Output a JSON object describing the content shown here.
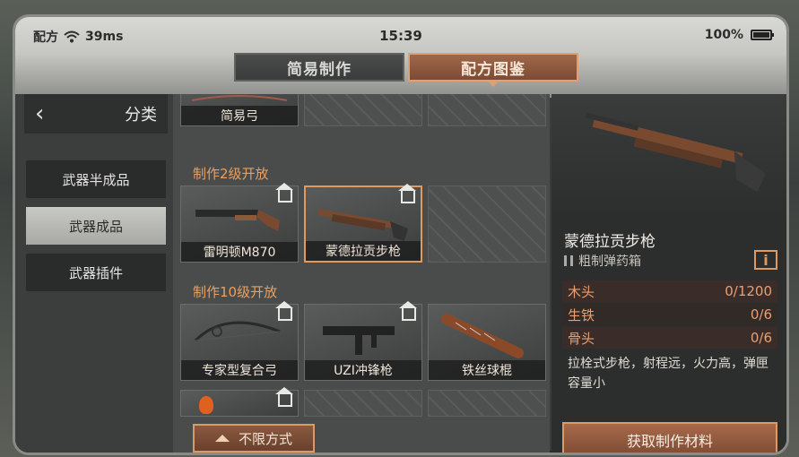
{
  "status": {
    "carrier": "配方",
    "ping": "39ms",
    "time": "15:39",
    "battery": "100%"
  },
  "tabs": [
    {
      "label": "简易制作",
      "active": false
    },
    {
      "label": "配方图鉴",
      "active": true
    }
  ],
  "sidebar": {
    "title": "分类",
    "items": [
      {
        "label": "武器半成品",
        "active": false
      },
      {
        "label": "武器成品",
        "active": true
      },
      {
        "label": "武器插件",
        "active": false
      }
    ]
  },
  "grid": {
    "top_item": "简易弓",
    "section2": "制作2级开放",
    "row2": [
      "雷明顿M870",
      "蒙德拉贡步枪"
    ],
    "section3": "制作10级开放",
    "row3": [
      "专家型复合弓",
      "UZI冲锋枪",
      "铁丝球棍"
    ],
    "filter_label": "不限方式"
  },
  "detail": {
    "name": "蒙德拉贡步枪",
    "ammo": "粗制弹药箱",
    "info": "i",
    "materials": [
      {
        "name": "木头",
        "count": "0/1200"
      },
      {
        "name": "生铁",
        "count": "0/6"
      },
      {
        "name": "骨头",
        "count": "0/6"
      }
    ],
    "description": "拉栓式步枪，射程远，火力高，弹匣容量小",
    "get_button": "获取制作材料"
  },
  "colors": {
    "accent": "#e09a60",
    "section": "#e8a060"
  }
}
